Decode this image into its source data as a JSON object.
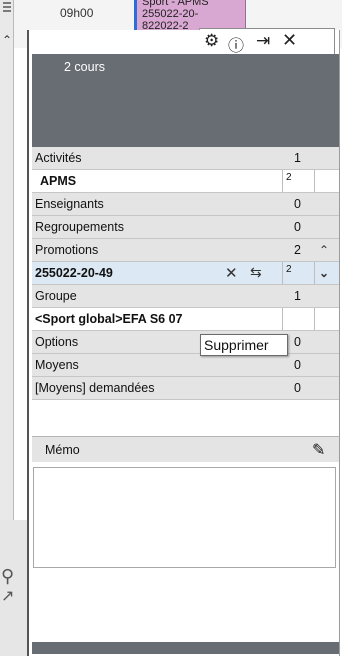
{
  "background": {
    "time_label": "09h00",
    "event_lines": [
      "Sport - APMS",
      "255022-20-",
      "822022-2"
    ]
  },
  "toolbar": {
    "settings_icon": "gear-icon",
    "info_icon": "info-icon",
    "detach_icon": "detach-icon",
    "close_icon": "close-icon"
  },
  "panel": {
    "title": "2 cours"
  },
  "rows": {
    "activites": {
      "label": "Activités",
      "count": "1"
    },
    "apms": {
      "label": "APMS",
      "value": "2"
    },
    "enseignants": {
      "label": "Enseignants",
      "count": "0"
    },
    "regroupements": {
      "label": "Regroupements",
      "count": "0"
    },
    "promotions": {
      "label": "Promotions",
      "count": "2"
    },
    "promo_item": {
      "label": "255022-20-49",
      "value": "2"
    },
    "groupe": {
      "label": "Groupe",
      "count": "1"
    },
    "groupe_item": {
      "label": "<Sport global>EFA S6 07"
    },
    "options": {
      "label": "Options",
      "count": "0"
    },
    "moyens": {
      "label": "Moyens",
      "count": "0"
    },
    "moyens_dem": {
      "label": "[Moyens] demandées",
      "count": "0"
    }
  },
  "tooltip": {
    "text": "Supprimer"
  },
  "memo": {
    "label": "Mémo"
  },
  "colors": {
    "header_bg": "#686d74",
    "section_bg": "#e4e4e4",
    "selected_bg": "#dde8f5",
    "event_bg": "#d9a8d2"
  }
}
